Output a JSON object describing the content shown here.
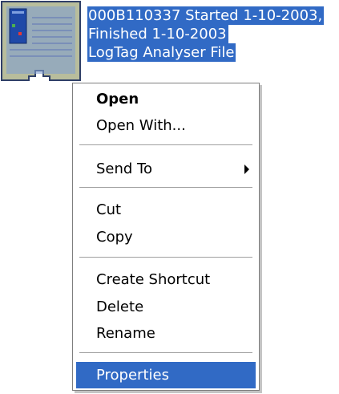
{
  "file": {
    "icon": "logtag-file-icon",
    "name_lines": [
      "000B110337 Started 1-10-2003,",
      "Finished 1-10-2003",
      "LogTag Analyser File"
    ]
  },
  "menu": {
    "items": [
      {
        "label": "Open",
        "bold": true
      },
      {
        "label": "Open With..."
      },
      {
        "label": "Send To",
        "submenu": true
      },
      {
        "label": "Cut"
      },
      {
        "label": "Copy"
      },
      {
        "label": "Create Shortcut"
      },
      {
        "label": "Delete"
      },
      {
        "label": "Rename"
      },
      {
        "label": "Properties",
        "highlighted": true
      }
    ]
  },
  "colors": {
    "selection": "#316ac5",
    "menu_border": "#7f7f7f"
  }
}
